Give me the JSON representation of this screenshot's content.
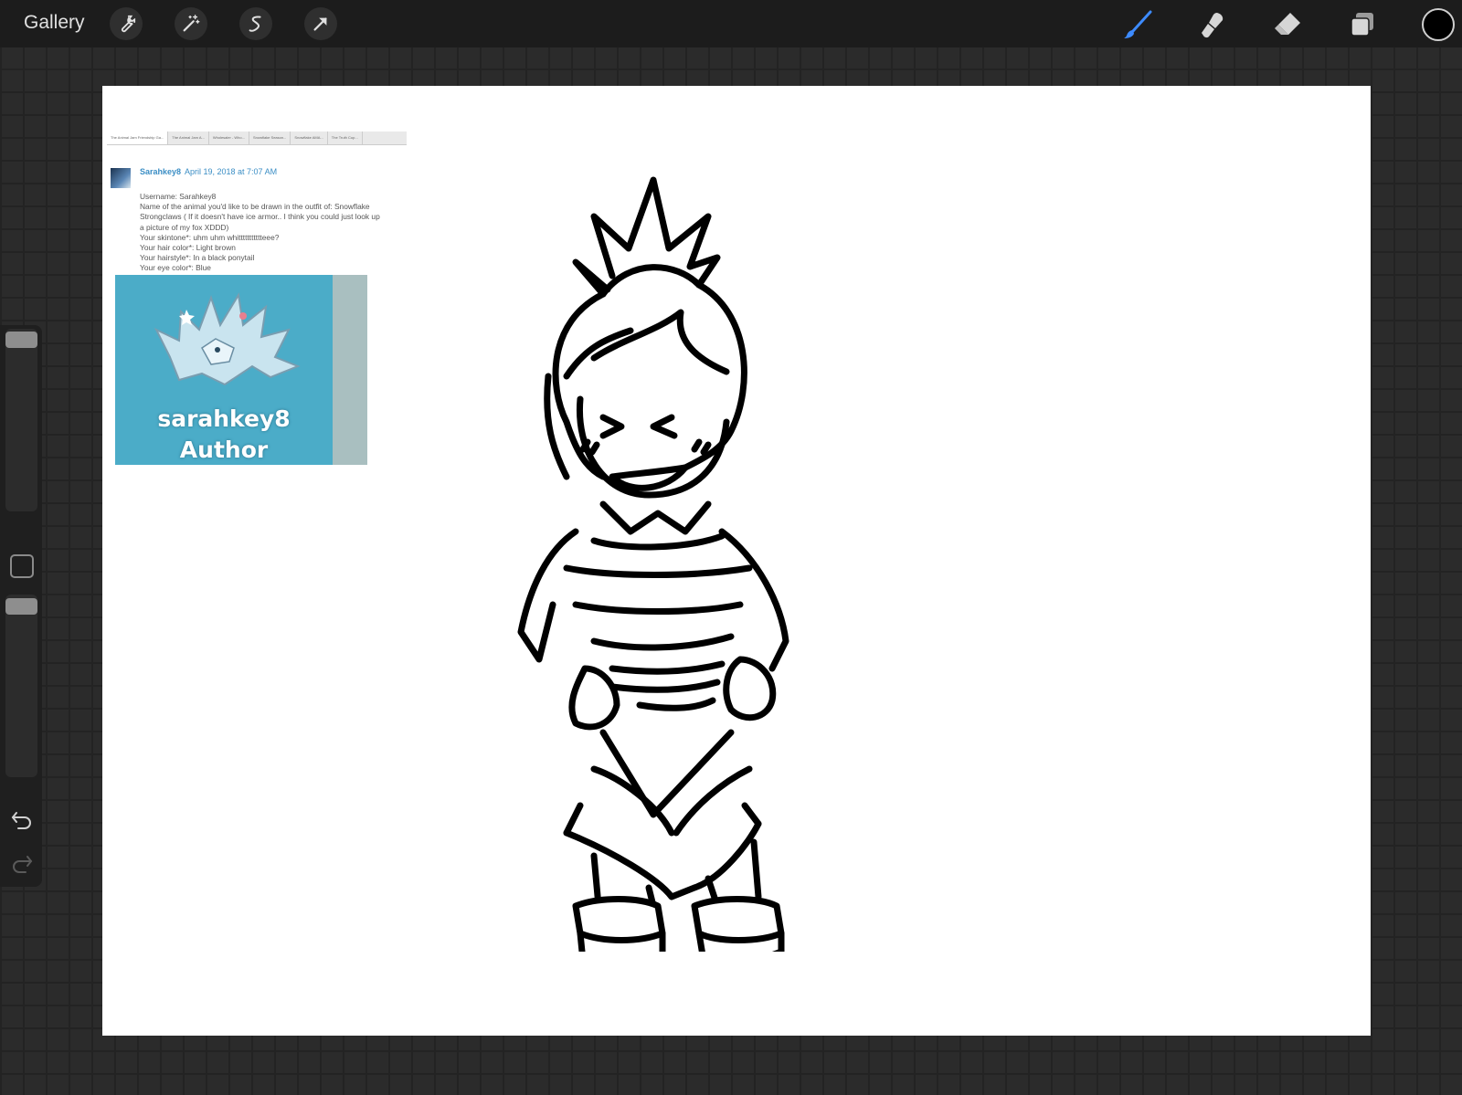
{
  "toolbar": {
    "gallery_label": "Gallery",
    "left_tools": [
      "wrench-icon",
      "magic-wand-icon",
      "selection-icon",
      "transform-arrow-icon"
    ],
    "right_tools": [
      "brush-icon",
      "smudge-icon",
      "eraser-icon",
      "layers-icon"
    ],
    "active_tool": "brush-icon",
    "accent_color": "#3d8bff",
    "current_color": "#000000"
  },
  "sidebar": {
    "brush_size_level": 0.05,
    "opacity_level": 0.05,
    "controls": [
      "modify-square-icon",
      "undo-icon",
      "redo-icon"
    ]
  },
  "reference": {
    "tabs": [
      "The Animal Jam Friendship Ga...",
      "The Animal Jam A...",
      "Wholesaler - Who...",
      "Snowflake Season...",
      "Snowflake AMA...",
      "The Truth Cup..."
    ],
    "username": "Sarahkey8",
    "date": "April 19, 2018 at 7:07 AM",
    "comment_lines": [
      "Username: Sarahkey8",
      "Name of the animal you'd like to be drawn in the outfit of: Snowflake",
      "Strongclaws ( If it doesn't have ice armor.. I think you could just look up",
      "a picture of my fox XDDD)",
      "Your skintone*: uhm uhm whittttttttttteee?",
      "Your hair color*: Light brown",
      "Your hairstyle*: In a black ponytail",
      "Your eye color*: Blue"
    ],
    "badge_line1": "sarahkey8",
    "badge_line2": "Author",
    "badge_color": "#4bacc8"
  }
}
